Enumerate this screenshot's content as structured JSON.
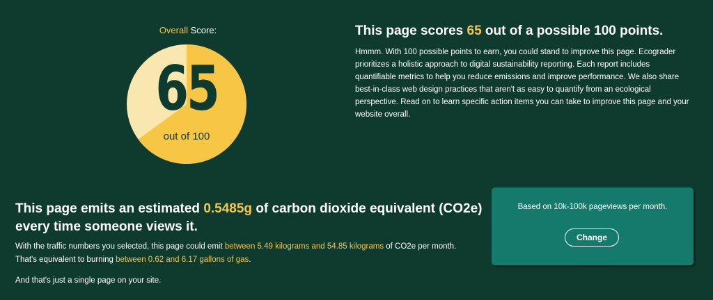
{
  "score": {
    "label_highlight": "Overall",
    "label_rest": " Score:",
    "value": "65",
    "out_of": "out of 100",
    "fraction": 0.65,
    "colors": {
      "filled": "#f6c644",
      "remaining": "#f9e7b0",
      "number": "#0f3a2e"
    },
    "title_pre": "This page scores ",
    "title_value": "65",
    "title_post": " out of a possible 100 points.",
    "description": "Hmmm. With 100 possible points to earn, you could stand to improve this page. Ecograder prioritizes a holistic approach to digital sustainability reporting. Each report includes quantifiable metrics to help you reduce emissions and improve performance. We also share best-in-class web design practices that aren't as easy to quantify from an ecological perspective. Read on to learn specific action items you can take to improve this page and your website overall."
  },
  "emissions": {
    "title_pre": "This page emits an estimated ",
    "title_value": "0.5485g",
    "title_post": " of carbon dioxide equivalent (CO2e) every time someone views it.",
    "desc_1": "With the traffic numbers you selected, this page could emit ",
    "desc_range": "between 5.49 kilograms and 54.85 kilograms",
    "desc_2": " of CO2e per month.",
    "desc_3": "That's equivalent to burning ",
    "desc_gas": "between 0.62 and 6.17 gallons of gas",
    "desc_4": ".",
    "single_page": "And that's just a single page on your site."
  },
  "traffic": {
    "text": "Based on 10k-100k pageviews per month.",
    "button": "Change"
  },
  "colors": {
    "background": "#0f3a2e",
    "accent": "#f6c644",
    "card": "#147a6c"
  }
}
